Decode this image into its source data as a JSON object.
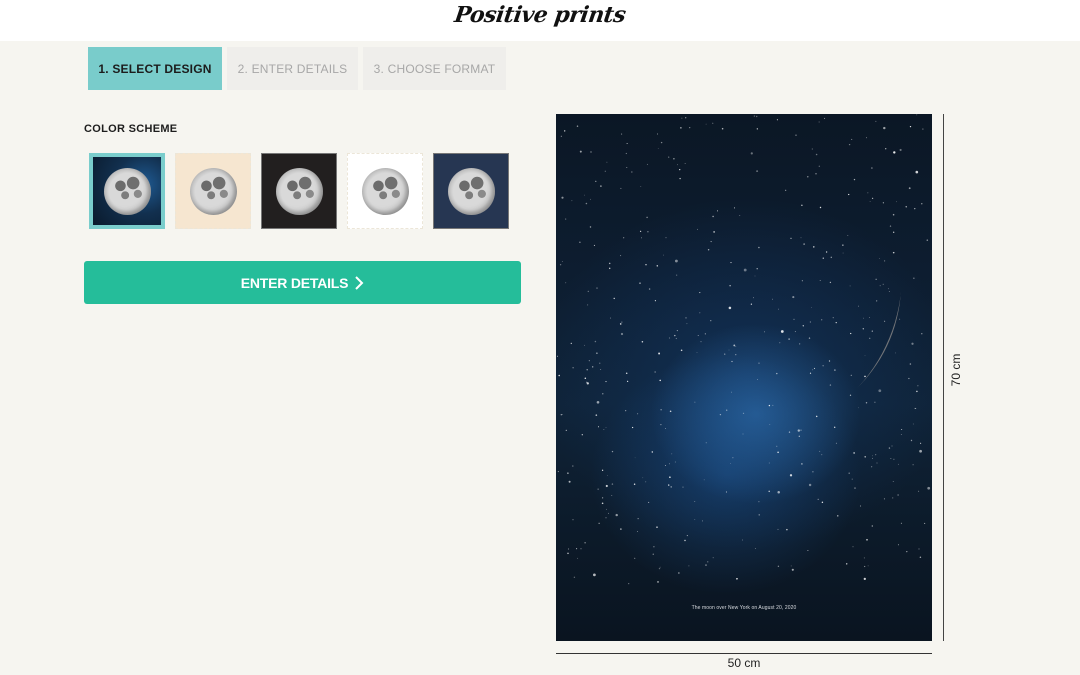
{
  "header": {
    "logo_text": "Positive prints"
  },
  "steps": [
    {
      "label": "1. Select Design",
      "active": true
    },
    {
      "label": "2. Enter Details",
      "active": false
    },
    {
      "label": "3. Choose Format",
      "active": false
    }
  ],
  "design": {
    "section_label": "COLOR SCHEME",
    "swatches": [
      {
        "name": "starry-blue",
        "background": "#0f2640",
        "selected": true
      },
      {
        "name": "cream",
        "background": "#f6e6d0",
        "selected": false
      },
      {
        "name": "black",
        "background": "#221f1f",
        "selected": false
      },
      {
        "name": "white",
        "background": "#ffffff",
        "selected": false
      },
      {
        "name": "navy",
        "background": "#263652",
        "selected": false
      }
    ],
    "cta_label": "ENTER DETAILS",
    "cta_icon": "chevron-right-icon"
  },
  "preview": {
    "caption": "The moon over New York on August 20, 2020",
    "width_label": "50 cm",
    "height_label": "70 cm"
  },
  "colors": {
    "accent_teal": "#79cccb",
    "cta_green": "#25bd9a",
    "page_bg": "#f6f5f0"
  }
}
